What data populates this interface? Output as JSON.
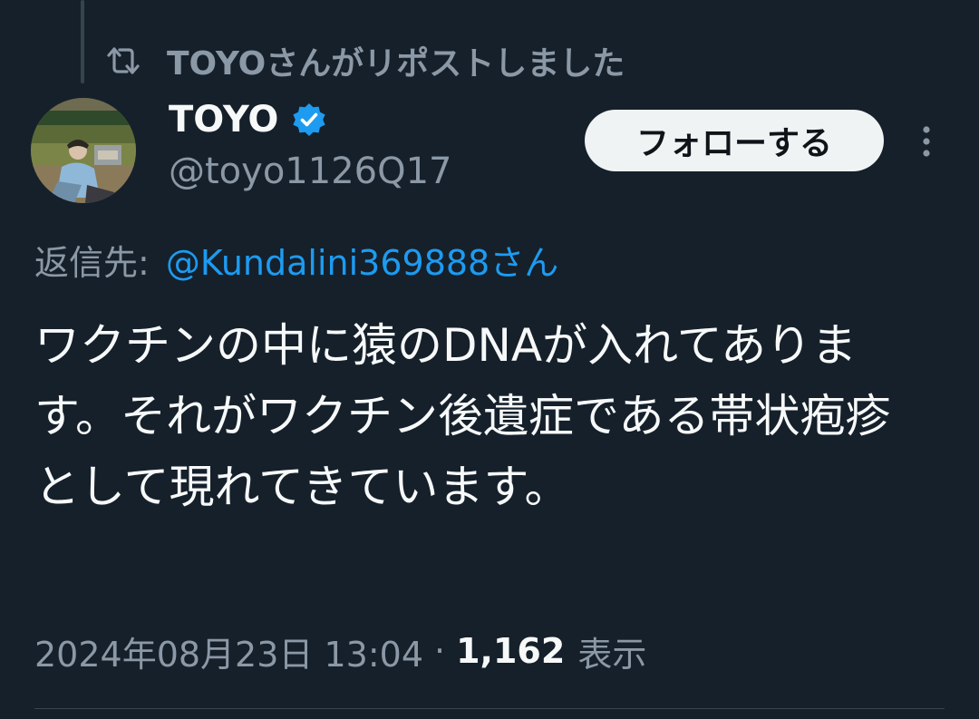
{
  "repost": {
    "icon": "repost-icon",
    "text": "TOYOさんがリポストしました"
  },
  "author": {
    "display_name": "TOYO",
    "handle": "@toyo1126Q17",
    "verified_icon": "verified-badge-icon",
    "verified_color": "#1d9bf0"
  },
  "actions": {
    "follow_label": "フォローする",
    "more_icon": "more-vertical-icon"
  },
  "reply": {
    "label": "返信先:",
    "mention": "@Kundalini369888さん"
  },
  "tweet": {
    "text": "ワクチンの中に猿のDNAが入れてあります。それがワクチン後遺症である帯状疱疹として現れてきています。"
  },
  "meta": {
    "timestamp": "2024年08月23日 13:04",
    "separator": "·",
    "views_count": "1,162",
    "views_label": "表示"
  },
  "colors": {
    "background": "#15202b",
    "text_primary": "#f7f9f9",
    "text_secondary": "#8b98a5",
    "accent": "#1d9bf0",
    "button_bg": "#eff3f4"
  }
}
